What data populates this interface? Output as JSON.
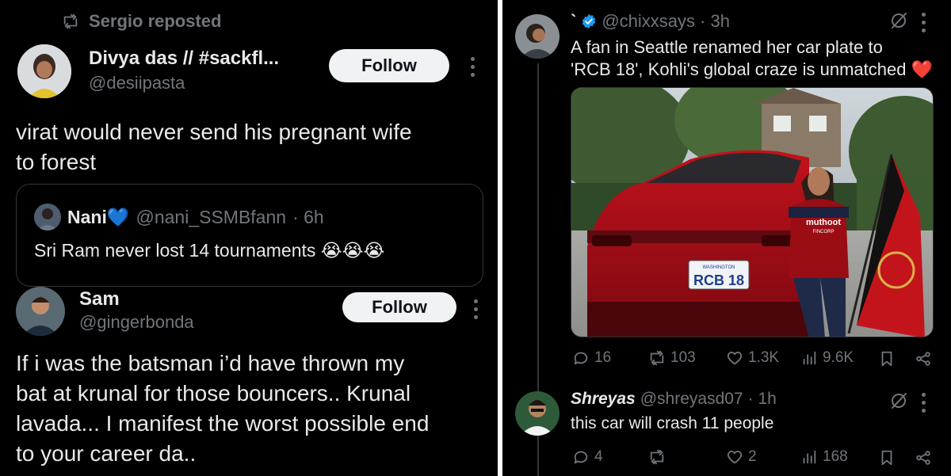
{
  "left": {
    "repost_label": "Sergio reposted",
    "post1": {
      "name": "Divya das // #sackfl...",
      "handle": "@desiipasta",
      "follow_label": "Follow",
      "text_line1": "virat would never send his pregnant wife",
      "text_line2": "to forest",
      "quote": {
        "name": "Nani💙",
        "handle": "@nani_SSMBfann",
        "time": "· 6h",
        "text": "Sri Ram never lost 14 tournaments 😭😭😭"
      }
    },
    "post2": {
      "name": "Sam",
      "handle": "@gingerbonda",
      "follow_label": "Follow",
      "text_line1": "If i was the batsman i’d have thrown my",
      "text_line2": "bat at krunal for those bouncers.. Krunal",
      "text_line3": "lavada... I manifest the worst possible end",
      "text_line4": "to your career da.."
    }
  },
  "right": {
    "post1": {
      "name": "`",
      "handle": "@chixxsays",
      "time": "· 3h",
      "text_line1": "A fan in Seattle renamed her car plate to",
      "text_line2": "'RCB 18', Kohli's global craze is unmatched ❤️",
      "plate_state": "WASHINGTON",
      "plate_text": "RCB 18",
      "shirt_text1": "muthoot",
      "shirt_text2": "FINCORP",
      "replies": "16",
      "reposts": "103",
      "likes": "1.3K",
      "views": "9.6K"
    },
    "post2": {
      "name": "Shreyas",
      "handle": "@shreyasd07",
      "time": "· 1h",
      "text": "this car will  crash 11 people",
      "replies": "4",
      "reposts": "",
      "likes": "2",
      "views": "168"
    }
  },
  "colors": {
    "background": "#000000",
    "text": "#e7e9ea",
    "muted": "#71767b",
    "verified": "#1d9bf0",
    "heart": "#f4212e",
    "follow_bg": "#eff3f4"
  }
}
